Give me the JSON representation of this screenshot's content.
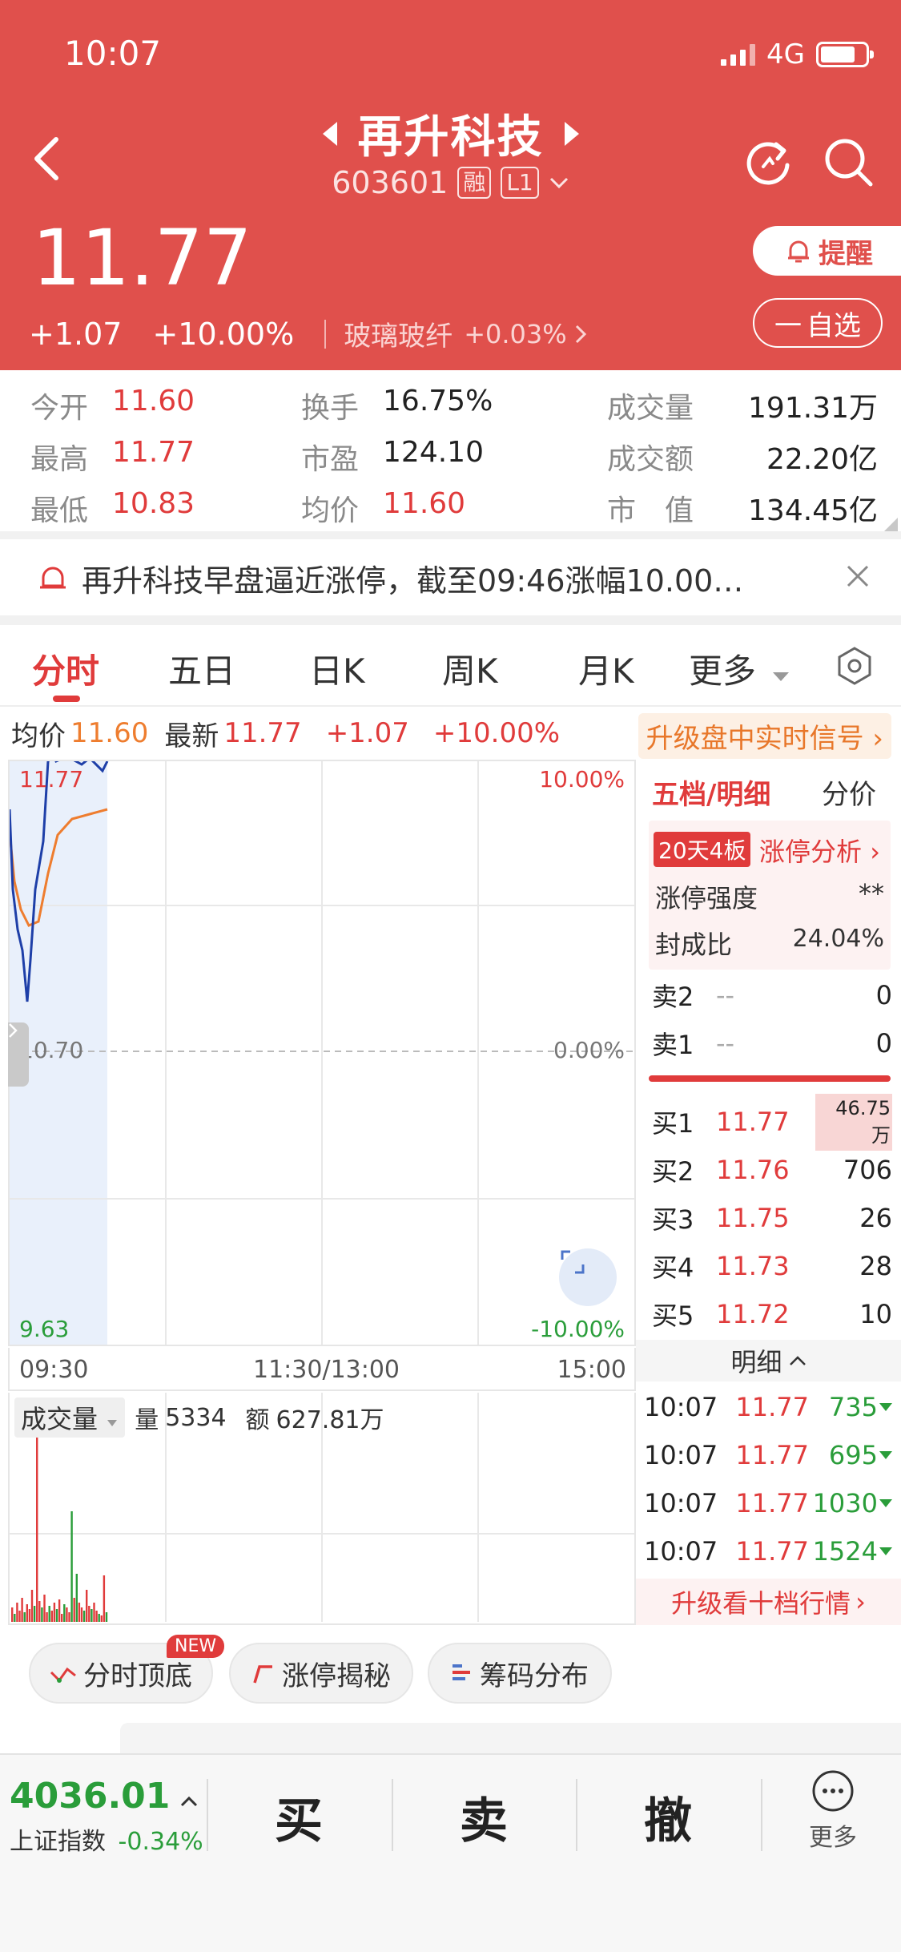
{
  "status_bar": {
    "time": "10:07",
    "network": "4G"
  },
  "stock": {
    "name": "再升科技",
    "code": "603601",
    "tag_margin": "融",
    "tag_level": "L1",
    "price": "11.77",
    "change": "+1.07",
    "change_pct": "+10.00%",
    "industry": "玻璃玻纤",
    "industry_pct": "+0.03%"
  },
  "header_buttons": {
    "remind": "提醒",
    "watch": "自选"
  },
  "stats": [
    {
      "label": "今开",
      "value": "11.60",
      "color": "red"
    },
    {
      "label": "换手",
      "value": "16.75%",
      "color": "black"
    },
    {
      "label": "成交量",
      "value": "191.31万",
      "color": "black"
    },
    {
      "label": "最高",
      "value": "11.77",
      "color": "red"
    },
    {
      "label": "市盈",
      "value": "124.10",
      "color": "black"
    },
    {
      "label": "成交额",
      "value": "22.20亿",
      "color": "black"
    },
    {
      "label": "最低",
      "value": "10.83",
      "color": "red"
    },
    {
      "label": "均价",
      "value": "11.60",
      "color": "red"
    },
    {
      "label": "市　值",
      "value": "134.45亿",
      "color": "black"
    }
  ],
  "news": {
    "text": "再升科技早盘逼近涨停，截至09:46涨幅10.00…"
  },
  "tabs": [
    "分时",
    "五日",
    "日K",
    "周K",
    "月K",
    "更多"
  ],
  "info_bar": {
    "avg_label": "均价",
    "avg_value": "11.60",
    "latest_label": "最新",
    "latest_value": "11.77",
    "change": "+1.07",
    "change_pct": "+10.00%",
    "upgrade": "升级盘中实时信号"
  },
  "chart": {
    "y_top": "11.77",
    "y_mid": "10.70",
    "y_bottom": "9.63",
    "pct_top": "10.00%",
    "pct_mid": "0.00%",
    "pct_bottom": "-10.00%",
    "time_start": "09:30",
    "time_mid": "11:30/13:00",
    "time_end": "15:00",
    "volume_label": "成交量",
    "volume_qty_label": "量",
    "volume_qty": "5334",
    "volume_amt_label": "额",
    "volume_amt": "627.81万",
    "colors": {
      "price": "#1e3fa8",
      "avg": "#ee7d2f",
      "up": "#e03b3b",
      "down": "#2a9d3a"
    }
  },
  "order_book": {
    "tab_five": "五档/明细",
    "tab_price": "分价",
    "limit_badge": "20天4板",
    "limit_link": "涨停分析",
    "strength_label": "涨停强度",
    "strength_value": "**",
    "seal_label": "封成比",
    "seal_value": "24.04%",
    "sells": [
      {
        "label": "卖2",
        "price": "--",
        "vol": "0"
      },
      {
        "label": "卖1",
        "price": "--",
        "vol": "0"
      }
    ],
    "buys": [
      {
        "label": "买1",
        "price": "11.77",
        "vol": "46.75万"
      },
      {
        "label": "买2",
        "price": "11.76",
        "vol": "706"
      },
      {
        "label": "买3",
        "price": "11.75",
        "vol": "26"
      },
      {
        "label": "买4",
        "price": "11.73",
        "vol": "28"
      },
      {
        "label": "买5",
        "price": "11.72",
        "vol": "10"
      }
    ],
    "detail_label": "明细",
    "trades": [
      {
        "time": "10:07",
        "price": "11.77",
        "vol": "735"
      },
      {
        "time": "10:07",
        "price": "11.77",
        "vol": "695"
      },
      {
        "time": "10:07",
        "price": "11.77",
        "vol": "1030"
      },
      {
        "time": "10:07",
        "price": "11.77",
        "vol": "1524"
      }
    ],
    "upgrade_ten": "升级看十档行情"
  },
  "tools": {
    "new_badge": "NEW",
    "t1": "分时顶底",
    "t2": "涨停揭秘",
    "t3": "筹码分布"
  },
  "bottom_bar": {
    "index_value": "4036.01",
    "index_name": "上证指数",
    "index_pct": "-0.34%",
    "buy": "买",
    "sell": "卖",
    "cancel": "撤",
    "more": "更多"
  }
}
